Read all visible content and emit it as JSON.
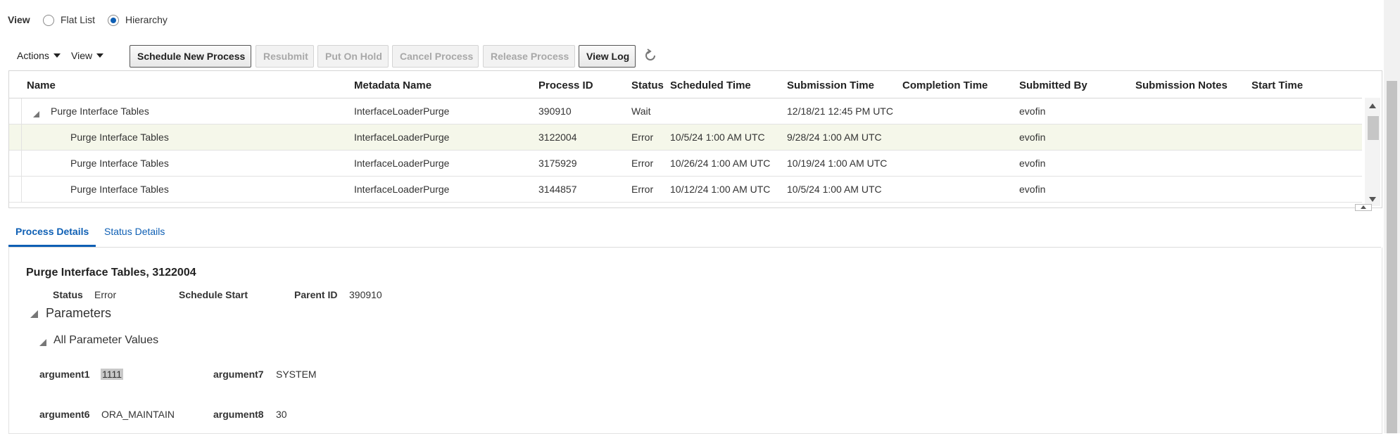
{
  "view_selector": {
    "label": "View",
    "options": [
      {
        "label": "Flat List",
        "selected": false
      },
      {
        "label": "Hierarchy",
        "selected": true
      }
    ]
  },
  "toolbar": {
    "actions_menu": "Actions",
    "view_menu": "View",
    "buttons": [
      {
        "label": "Schedule New Process",
        "enabled": true
      },
      {
        "label": "Resubmit",
        "enabled": false
      },
      {
        "label": "Put On Hold",
        "enabled": false
      },
      {
        "label": "Cancel Process",
        "enabled": false
      },
      {
        "label": "Release Process",
        "enabled": false
      },
      {
        "label": "View Log",
        "enabled": true
      }
    ],
    "refresh_icon": "refresh-icon"
  },
  "table": {
    "columns": [
      "Name",
      "Metadata Name",
      "Process ID",
      "Status",
      "Scheduled Time",
      "Submission Time",
      "Completion Time",
      "Submitted By",
      "Submission Notes",
      "Start Time"
    ],
    "rows": [
      {
        "name": "Purge Interface Tables",
        "metadata": "InterfaceLoaderPurge",
        "process_id": "390910",
        "status": "Wait",
        "scheduled": "",
        "submission": "12/18/21 12:45 PM UTC",
        "completion": "",
        "submitted_by": "evofin",
        "notes": "",
        "start": "",
        "expanded": true,
        "level": 0
      },
      {
        "name": "Purge Interface Tables",
        "metadata": "InterfaceLoaderPurge",
        "process_id": "3122004",
        "status": "Error",
        "scheduled": "10/5/24 1:00 AM UTC",
        "submission": "9/28/24 1:00 AM UTC",
        "completion": "",
        "submitted_by": "evofin",
        "notes": "",
        "start": "",
        "selected": true,
        "level": 1
      },
      {
        "name": "Purge Interface Tables",
        "metadata": "InterfaceLoaderPurge",
        "process_id": "3175929",
        "status": "Error",
        "scheduled": "10/26/24 1:00 AM UTC",
        "submission": "10/19/24 1:00 AM UTC",
        "completion": "",
        "submitted_by": "evofin",
        "notes": "",
        "start": "",
        "level": 1
      },
      {
        "name": "Purge Interface Tables",
        "metadata": "InterfaceLoaderPurge",
        "process_id": "3144857",
        "status": "Error",
        "scheduled": "10/12/24 1:00 AM UTC",
        "submission": "10/5/24 1:00 AM UTC",
        "completion": "",
        "submitted_by": "evofin",
        "notes": "",
        "start": "",
        "level": 1
      }
    ]
  },
  "tabs": [
    {
      "label": "Process Details",
      "active": true
    },
    {
      "label": "Status Details",
      "active": false
    }
  ],
  "details": {
    "title": "Purge Interface Tables, 3122004",
    "status_label": "Status",
    "status_value": "Error",
    "schedule_start_label": "Schedule Start",
    "schedule_start_value": "",
    "parent_id_label": "Parent ID",
    "parent_id_value": "390910",
    "parameters_heading": "Parameters",
    "all_values_heading": "All Parameter Values",
    "arguments": [
      {
        "label": "argument1",
        "value": "1111"
      },
      {
        "label": "argument7",
        "value": "SYSTEM"
      },
      {
        "label": "argument6",
        "value": "ORA_MAINTAIN"
      },
      {
        "label": "argument8",
        "value": "30"
      }
    ]
  },
  "colors": {
    "accent": "#0e5fb4",
    "selected_row": "#f5f7ea"
  }
}
